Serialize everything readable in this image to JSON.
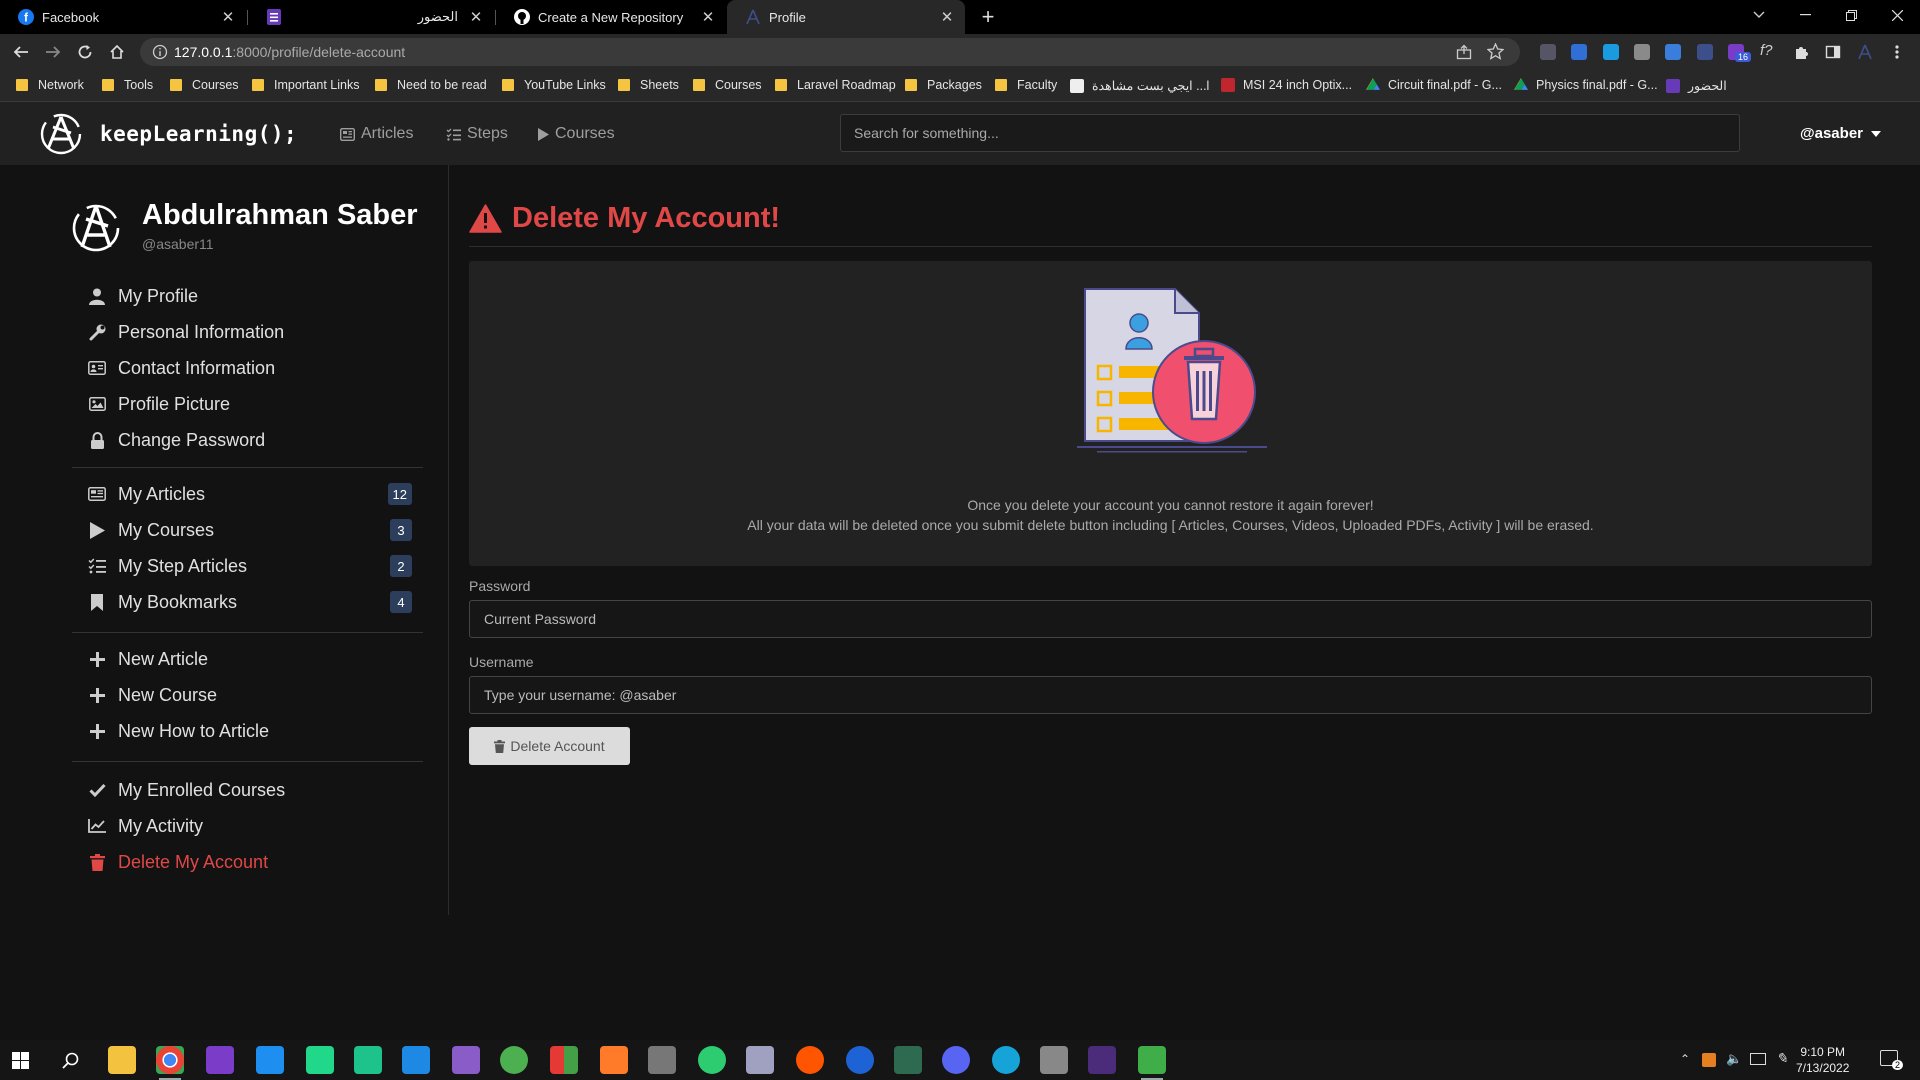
{
  "browser": {
    "tabs": [
      {
        "title": "Facebook",
        "icon": "facebook-icon"
      },
      {
        "title": "الحضور",
        "icon": "forms-icon"
      },
      {
        "title": "Create a New Repository",
        "icon": "github-icon"
      },
      {
        "title": "Profile",
        "icon": "site-logo-icon",
        "active": true
      }
    ],
    "url_host": "127.0.0.1",
    "url_path": ":8000/profile/delete-account",
    "bookmarks": [
      "Network",
      "Tools",
      "Courses",
      "Important Links",
      "Need to be read",
      "YouTube Links",
      "Sheets",
      "Courses",
      "Laravel Roadmap",
      "Packages",
      "Faculty",
      "ايجي بست مشاهدة ...l",
      "MSI 24 inch Optix...",
      "Circuit final.pdf - G...",
      "Physics final.pdf - G...",
      "الحضور"
    ],
    "extension_badge": "16"
  },
  "site": {
    "brand": "keepLearning();",
    "nav": {
      "articles": "Articles",
      "steps": "Steps",
      "courses": "Courses"
    },
    "search_placeholder": "Search for something...",
    "user": "@asaber"
  },
  "sidebar": {
    "name": "Abdulrahman Saber",
    "handle": "@asaber11",
    "group1": [
      "My Profile",
      "Personal Information",
      "Contact Information",
      "Profile Picture",
      "Change Password"
    ],
    "group2": [
      {
        "label": "My Articles",
        "count": "12"
      },
      {
        "label": "My Courses",
        "count": "3"
      },
      {
        "label": "My Step Articles",
        "count": "2"
      },
      {
        "label": "My Bookmarks",
        "count": "4"
      }
    ],
    "group3": [
      "New Article",
      "New Course",
      "New How to Article"
    ],
    "group4": [
      "My Enrolled Courses",
      "My Activity",
      "Delete My Account"
    ]
  },
  "main": {
    "title": "Delete My Account!",
    "warning_line1": "Once you delete your account you cannot restore it again forever!",
    "warning_line2": "All your data will be deleted once you submit delete button including [ Articles, Courses, Videos, Uploaded PDFs, Activity ] will be erased.",
    "password_label": "Password",
    "password_placeholder": "Current Password",
    "username_label": "Username",
    "username_placeholder": "Type your username: @asaber",
    "delete_button": "Delete Account"
  },
  "colors": {
    "danger": "#e04848",
    "badge": "#2c3e5c",
    "illustration_red": "#f0506e",
    "illustration_orange": "#f7b500"
  },
  "taskbar": {
    "time": "9:10 PM",
    "date": "7/13/2022",
    "notification_count": "2"
  }
}
